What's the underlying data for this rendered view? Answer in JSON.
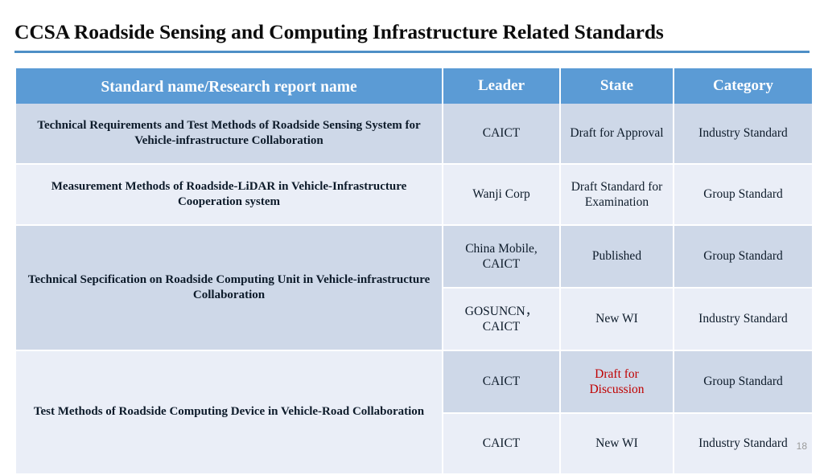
{
  "slide": {
    "title": "CCSA Roadside Sensing and Computing Infrastructure Related Standards",
    "page_number": "18",
    "accent_color": "#5b9bd5",
    "rule_color": "#4e8fc6",
    "band_dark_color": "#ced8e8",
    "band_light_color": "#eaeef7",
    "alert_color": "#c00000"
  },
  "table": {
    "headers": {
      "name": "Standard name/Research report name",
      "leader": "Leader",
      "state": "State",
      "category": "Category"
    },
    "rows": [
      {
        "name": "Technical Requirements and Test Methods of Roadside Sensing System for Vehicle-infrastructure Collaboration",
        "leader": "CAICT",
        "state": "Draft for Approval",
        "state_highlight": false,
        "category": "Industry Standard"
      },
      {
        "name": "Measurement Methods of Roadside-LiDAR in Vehicle-Infrastructure Cooperation system",
        "leader": "Wanji Corp",
        "state": "Draft Standard for Examination",
        "state_highlight": false,
        "category": "Group Standard"
      },
      {
        "name": "Technical Sepcification on Roadside Computing Unit in Vehicle-infrastructure Collaboration",
        "leader": "China Mobile, CAICT",
        "state": "Published",
        "state_highlight": false,
        "category": "Group Standard"
      },
      {
        "name": "",
        "leader": "GOSUNCN， CAICT",
        "state": "New WI",
        "state_highlight": false,
        "category": "Industry Standard"
      },
      {
        "name": "Test Methods of Roadside Computing Device in Vehicle-Road Collaboration",
        "leader": "CAICT",
        "state": "Draft for Discussion",
        "state_highlight": true,
        "category": "Group Standard"
      },
      {
        "name": "",
        "leader": "CAICT",
        "state": "New WI",
        "state_highlight": false,
        "category": "Industry Standard"
      }
    ]
  }
}
